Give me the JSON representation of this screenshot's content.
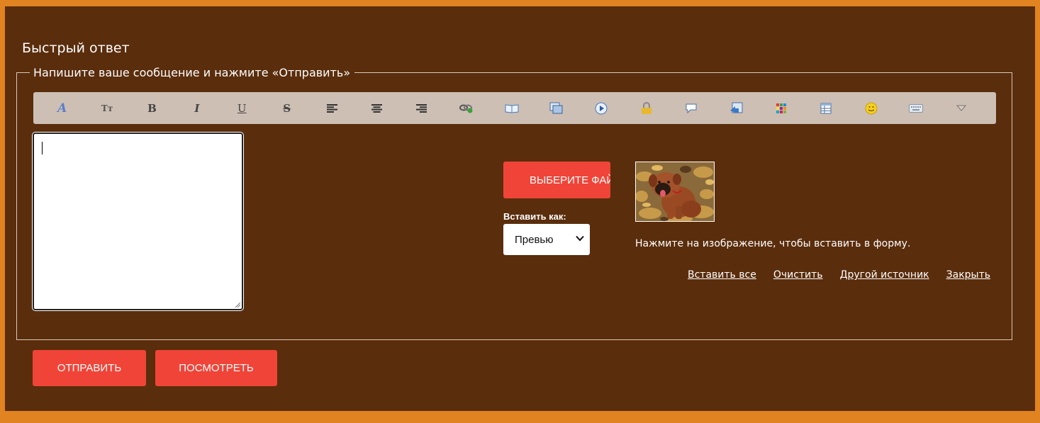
{
  "panel": {
    "title": "Быстрый ответ",
    "legend": "Напишите ваше сообщение и нажмите «Отправить»"
  },
  "toolbar": {
    "buttons": [
      {
        "icon": "font-icon",
        "label": "A"
      },
      {
        "icon": "font-size-icon",
        "label": "Tт"
      },
      {
        "icon": "bold-icon",
        "label": "B"
      },
      {
        "icon": "italic-icon",
        "label": "I"
      },
      {
        "icon": "underline-icon",
        "label": "U"
      },
      {
        "icon": "strikethrough-icon",
        "label": "S"
      },
      {
        "icon": "align-left-icon",
        "label": ""
      },
      {
        "icon": "align-center-icon",
        "label": ""
      },
      {
        "icon": "align-right-icon",
        "label": ""
      },
      {
        "icon": "link-icon",
        "label": ""
      },
      {
        "icon": "book-icon",
        "label": ""
      },
      {
        "icon": "image-icon",
        "label": ""
      },
      {
        "icon": "video-icon",
        "label": ""
      },
      {
        "icon": "lock-icon",
        "label": ""
      },
      {
        "icon": "quote-icon",
        "label": ""
      },
      {
        "icon": "code-icon",
        "label": ""
      },
      {
        "icon": "color-icon",
        "label": ""
      },
      {
        "icon": "table-icon",
        "label": ""
      },
      {
        "icon": "smiley-icon",
        "label": ""
      },
      {
        "icon": "keyboard-icon",
        "label": ""
      },
      {
        "icon": "more-icon",
        "label": ""
      }
    ]
  },
  "editor": {
    "value": ""
  },
  "upload": {
    "file_button": "Выберите файл",
    "insert_as_label": "Вставить как:",
    "insert_as_value": "Превью",
    "hint": "Нажмите на изображение, чтобы вставить в форму.",
    "links": {
      "insert_all": "Вставить все",
      "clear": "Очистить",
      "other_source": "Другой источник",
      "close": "Закрыть"
    }
  },
  "actions": {
    "send": "Отправить",
    "preview": "Посмотреть"
  },
  "colors": {
    "frame": "#e08320",
    "panel": "#5a2d0c",
    "toolbar": "#cdbfb4",
    "button": "#f04438"
  }
}
